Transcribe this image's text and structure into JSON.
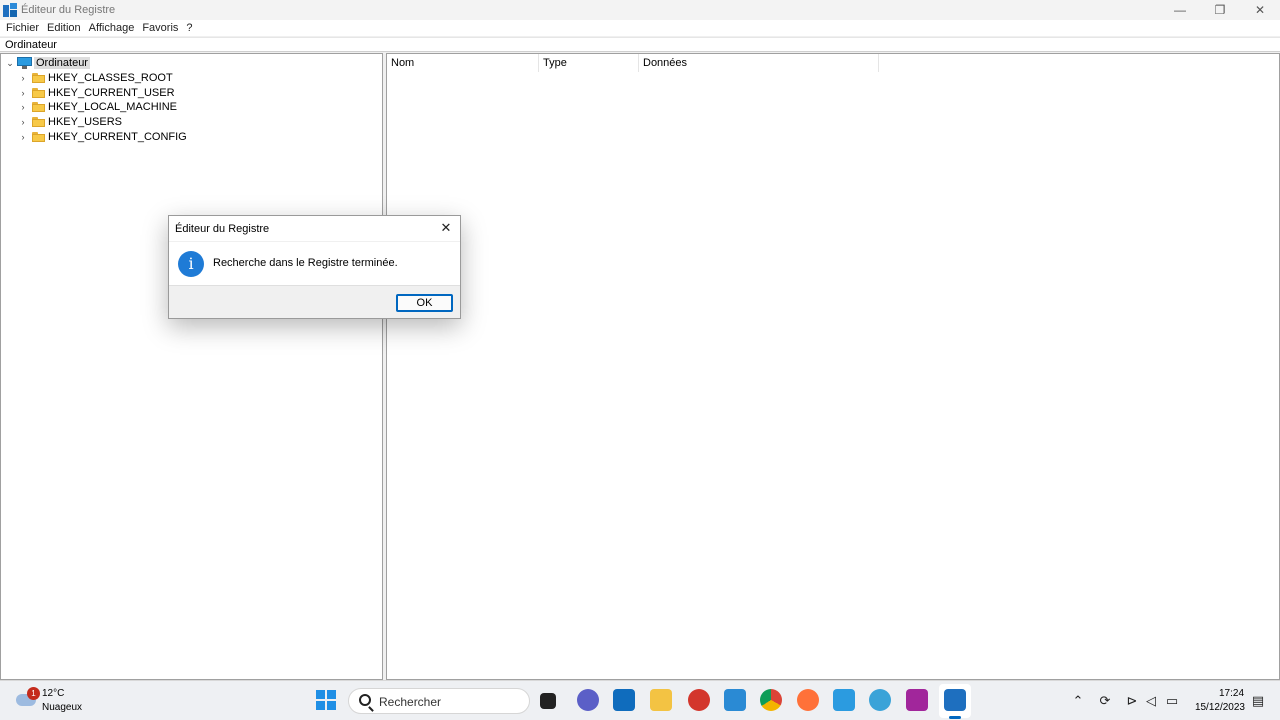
{
  "window": {
    "title": "Éditeur du Registre",
    "controls": [
      "—",
      "❐",
      "✕"
    ]
  },
  "menu": [
    "Fichier",
    "Edition",
    "Affichage",
    "Favoris",
    "?"
  ],
  "address": "Ordinateur",
  "tree": {
    "root": "Ordinateur",
    "children": [
      "HKEY_CLASSES_ROOT",
      "HKEY_CURRENT_USER",
      "HKEY_LOCAL_MACHINE",
      "HKEY_USERS",
      "HKEY_CURRENT_CONFIG"
    ]
  },
  "list": {
    "columns": [
      "Nom",
      "Type",
      "Données"
    ]
  },
  "dialog": {
    "title": "Éditeur du Registre",
    "message": "Recherche dans le Registre terminée.",
    "ok_label": "OK",
    "close_glyph": "✕",
    "icon_glyph": "i"
  },
  "taskbar": {
    "weather": {
      "badge": "1",
      "temp": "12°C",
      "desc": "Nuageux"
    },
    "search_label": "Rechercher",
    "apps": [
      "task-view",
      "teams",
      "outlook",
      "file-explorer",
      "ccleaner",
      "store",
      "chrome",
      "firefox",
      "remote-desktop",
      "vpn",
      "clion",
      "registry-editor"
    ],
    "tray": [
      "chevron-up-icon",
      "sync-icon",
      "network-icon",
      "volume-muted-icon",
      "battery-icon",
      "notification-icon"
    ],
    "time": "17:24",
    "date": "15/12/2023"
  }
}
